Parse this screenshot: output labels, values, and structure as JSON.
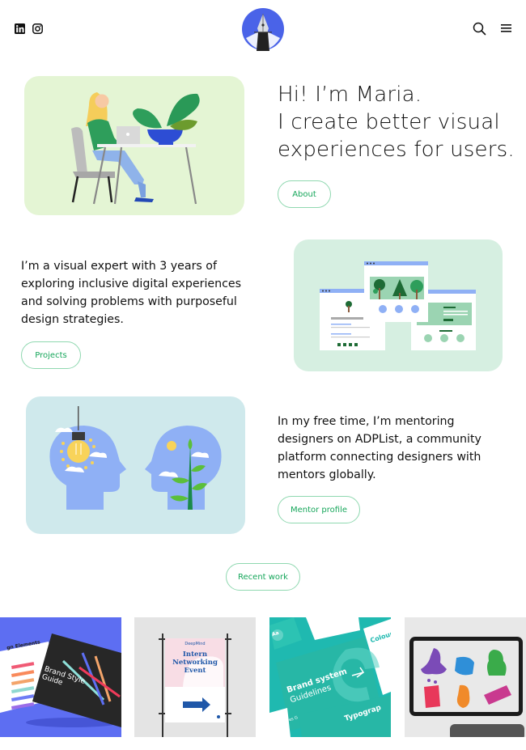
{
  "header": {
    "social": [
      {
        "name": "linkedin",
        "label": "LinkedIn"
      },
      {
        "name": "instagram",
        "label": "Instagram"
      }
    ],
    "logo_alt": "Pen nib logo",
    "search_label": "Search",
    "menu_label": "Menu"
  },
  "hero": {
    "lines": [
      "Hi! I’m Maria.",
      "I create better visual",
      "experiences for users."
    ],
    "button_label": "About",
    "illustration_alt": "Woman working on laptop at desk with plant"
  },
  "projects_section": {
    "lines": [
      "I’m a visual expert with 3 years of",
      "exploring inclusive digital experiences",
      "and solving problems with purposeful",
      "design strategies."
    ],
    "button_label": "Projects",
    "illustration_alt": "Website wireframes with trees"
  },
  "mentor_section": {
    "lines": [
      "In my free time, I’m mentoring",
      "designers on ADPList, a community",
      "platform connecting designers with",
      "mentors globally."
    ],
    "button_label": "Mentor profile",
    "illustration_alt": "Two heads with lightbulb and plant"
  },
  "recent_work": {
    "button_label": "Recent work",
    "items": [
      {
        "title": "Brand Style Guide",
        "side_title": "gn Elements"
      },
      {
        "brand": "DeepMind",
        "title_lines": [
          "Intern",
          "Networking",
          "Event"
        ]
      },
      {
        "title_lines": [
          "Brand system",
          "Guidelines"
        ],
        "side_labels": [
          "Colour",
          "Typograp",
          "Aa"
        ],
        "brand": "Gives G"
      },
      {
        "title": "Hygiene icons on tablet"
      }
    ]
  },
  "colors": {
    "accent_green": "#15a65a",
    "button_border": "#8fd8b0",
    "logo_blue": "#4a63e8",
    "hero_card_bg": "#e4f5d4",
    "projects_card_bg": "#d6efe1",
    "mentor_card_bg": "#cfe9ec"
  }
}
